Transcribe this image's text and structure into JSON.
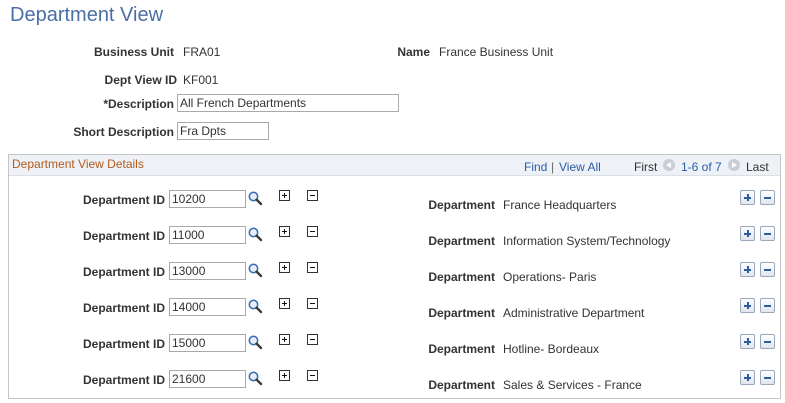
{
  "page": {
    "title": "Department View"
  },
  "header_fields": {
    "business_unit": {
      "label": "Business Unit",
      "value": "FRA01"
    },
    "name": {
      "label": "Name",
      "value": "France Business Unit"
    },
    "dept_view_id": {
      "label": "Dept View ID",
      "value": "KF001"
    },
    "description": {
      "label": "*Description",
      "value": "All French Departments"
    },
    "short_description": {
      "label": "Short Description",
      "value": "Fra Dpts"
    }
  },
  "grid": {
    "title": "Department View Details",
    "find_label": "Find",
    "separator": "|",
    "view_all_label": "View All",
    "first_label": "First",
    "range_label": "1-6 of 7",
    "last_label": "Last",
    "dept_id_label": "Department ID",
    "dept_label": "Department",
    "rows": [
      {
        "dept_id": "10200",
        "department": "France Headquarters"
      },
      {
        "dept_id": "11000",
        "department": "Information System/Technology"
      },
      {
        "dept_id": "13000",
        "department": "Operations- Paris"
      },
      {
        "dept_id": "14000",
        "department": "Administrative Department"
      },
      {
        "dept_id": "15000",
        "department": "Hotline- Bordeaux"
      },
      {
        "dept_id": "21600",
        "department": "Sales & Services - France"
      }
    ]
  },
  "icons": {
    "lookup": "search-icon",
    "add_row": "plus-icon",
    "delete_row": "minus-icon",
    "prev": "chevron-left-icon",
    "next": "chevron-right-icon"
  },
  "colors": {
    "title": "#4a6fa5",
    "grid_title": "#b35a1f",
    "link": "#2a5ea8",
    "grid_header_bg": "#eef1f5"
  }
}
